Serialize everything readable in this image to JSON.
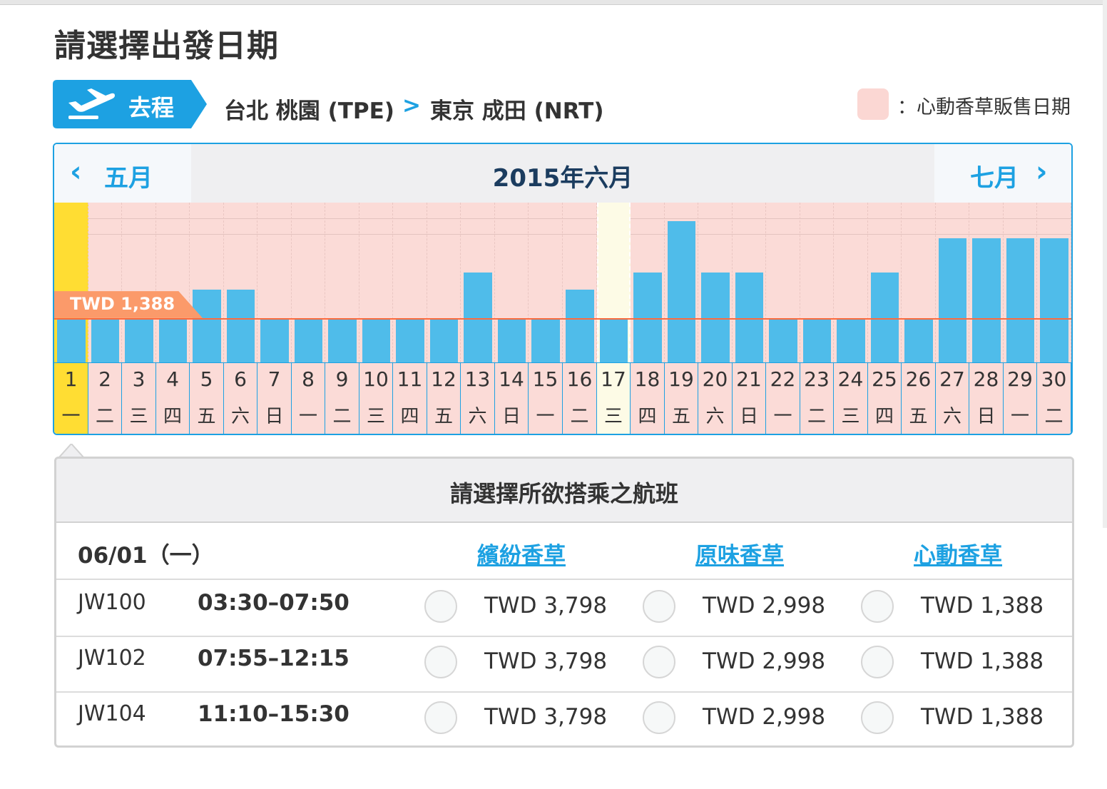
{
  "page": {
    "title": "請選擇出發日期"
  },
  "route": {
    "label": "去程",
    "origin": "台北 桃園 (TPE)",
    "arrow": ">",
    "destination": "東京 成田 (NRT)"
  },
  "legend": {
    "text": "：心動香草販售日期",
    "color": "#fbd7d3"
  },
  "calendar": {
    "prev_label": "五月",
    "next_label": "七月",
    "title": "2015年六月",
    "min_price_tag": "TWD 1,388",
    "selected_day": 1,
    "highlighted_day": 17,
    "accent_color": "#1da1e2",
    "selected_color": "#ffdd33",
    "bar_color": "#4fbcea",
    "days": [
      {
        "num": "1",
        "wk": "一"
      },
      {
        "num": "2",
        "wk": "二"
      },
      {
        "num": "3",
        "wk": "三"
      },
      {
        "num": "4",
        "wk": "四"
      },
      {
        "num": "5",
        "wk": "五"
      },
      {
        "num": "6",
        "wk": "六"
      },
      {
        "num": "7",
        "wk": "日"
      },
      {
        "num": "8",
        "wk": "一"
      },
      {
        "num": "9",
        "wk": "二"
      },
      {
        "num": "10",
        "wk": "三"
      },
      {
        "num": "11",
        "wk": "四"
      },
      {
        "num": "12",
        "wk": "五"
      },
      {
        "num": "13",
        "wk": "六"
      },
      {
        "num": "14",
        "wk": "日"
      },
      {
        "num": "15",
        "wk": "一"
      },
      {
        "num": "16",
        "wk": "二"
      },
      {
        "num": "17",
        "wk": "三"
      },
      {
        "num": "18",
        "wk": "四"
      },
      {
        "num": "19",
        "wk": "五"
      },
      {
        "num": "20",
        "wk": "六"
      },
      {
        "num": "21",
        "wk": "日"
      },
      {
        "num": "22",
        "wk": "一"
      },
      {
        "num": "23",
        "wk": "二"
      },
      {
        "num": "24",
        "wk": "三"
      },
      {
        "num": "25",
        "wk": "四"
      },
      {
        "num": "26",
        "wk": "五"
      },
      {
        "num": "27",
        "wk": "六"
      },
      {
        "num": "28",
        "wk": "日"
      },
      {
        "num": "29",
        "wk": "一"
      },
      {
        "num": "30",
        "wk": "二"
      }
    ],
    "bar_levels": [
      1,
      1,
      1,
      1,
      1.7,
      1.7,
      1,
      1,
      1,
      1,
      1,
      1,
      2.1,
      1,
      1,
      1.7,
      1,
      2.1,
      3.3,
      2.1,
      2.1,
      1,
      1,
      1,
      2.1,
      1,
      2.9,
      2.9,
      2.9,
      2.9
    ]
  },
  "flights": {
    "panel_title": "請選擇所欲搭乘之航班",
    "date_label": "06/01（一）",
    "fare_types": [
      "繽紛香草",
      "原味香草",
      "心動香草"
    ],
    "rows": [
      {
        "flight": "JW100",
        "time": "03:30–07:50",
        "prices": [
          "TWD 3,798",
          "TWD 2,998",
          "TWD 1,388"
        ]
      },
      {
        "flight": "JW102",
        "time": "07:55–12:15",
        "prices": [
          "TWD 3,798",
          "TWD 2,998",
          "TWD 1,388"
        ]
      },
      {
        "flight": "JW104",
        "time": "11:10–15:30",
        "prices": [
          "TWD 3,798",
          "TWD 2,998",
          "TWD 1,388"
        ]
      }
    ]
  }
}
